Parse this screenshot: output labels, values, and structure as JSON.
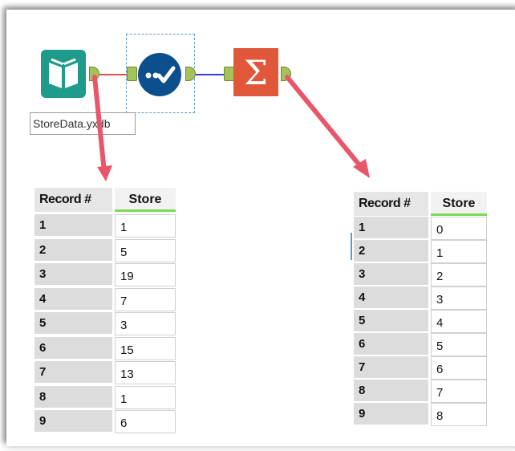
{
  "workflow": {
    "input_file_label": "StoreData.yxdb",
    "tools": [
      {
        "name": "input-data-tool",
        "icon": "book-icon",
        "color": "#1e9b8a"
      },
      {
        "name": "sample-tool",
        "icon": "checkmark-dots-icon",
        "color": "#0b4f8c"
      },
      {
        "name": "summarize-tool",
        "icon": "sigma-icon",
        "color": "#e0573a"
      }
    ],
    "connector_colors": {
      "input_to_sample": "#e0504a",
      "sample_to_summarize": "#3b3bdc"
    },
    "arrow_color": "#e8566a"
  },
  "left_table": {
    "headers": {
      "record": "Record #",
      "store": "Store"
    },
    "rows": [
      {
        "record": "1",
        "store": "1"
      },
      {
        "record": "2",
        "store": "5"
      },
      {
        "record": "3",
        "store": "19"
      },
      {
        "record": "4",
        "store": "7"
      },
      {
        "record": "5",
        "store": "3"
      },
      {
        "record": "6",
        "store": "15"
      },
      {
        "record": "7",
        "store": "13"
      },
      {
        "record": "8",
        "store": "1"
      },
      {
        "record": "9",
        "store": "6"
      }
    ]
  },
  "right_table": {
    "headers": {
      "record": "Record #",
      "store": "Store"
    },
    "rows": [
      {
        "record": "1",
        "store": "0"
      },
      {
        "record": "2",
        "store": "1"
      },
      {
        "record": "3",
        "store": "2"
      },
      {
        "record": "4",
        "store": "3"
      },
      {
        "record": "5",
        "store": "4"
      },
      {
        "record": "6",
        "store": "5"
      },
      {
        "record": "7",
        "store": "6"
      },
      {
        "record": "8",
        "store": "7"
      },
      {
        "record": "9",
        "store": "8"
      }
    ]
  }
}
